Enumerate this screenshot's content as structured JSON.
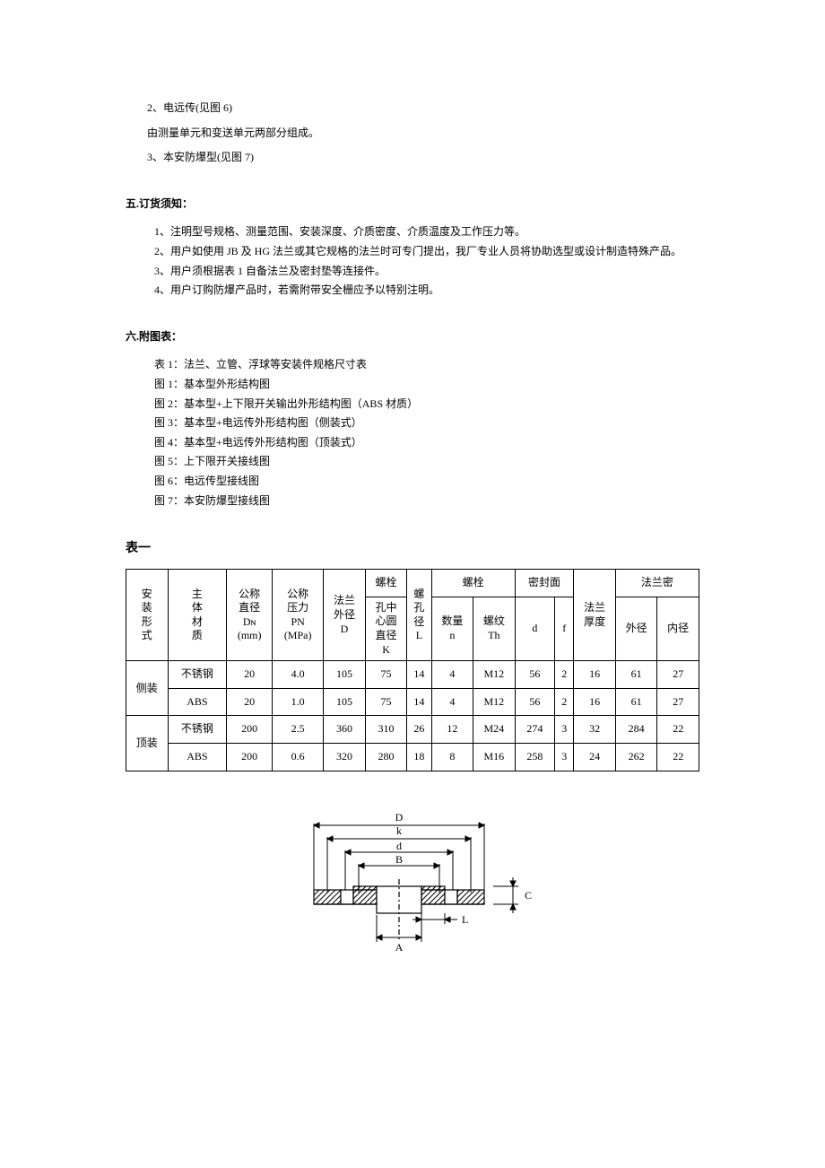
{
  "intro": {
    "line1": "2、电远传(见图 6)",
    "line2": "由测量单元和变送单元两部分组成。",
    "line3": "3、本安防爆型(见图 7)"
  },
  "section5": {
    "title": "五.订货须知：",
    "items": [
      "1、注明型号规格、测量范围、安装深度、介质密度、介质温度及工作压力等。",
      "2、用户如使用 JB 及 HG 法兰或其它规格的法兰时可专门提出，我厂专业人员将协助选型或设计制造特殊产品。",
      "3、用户须根据表 1 自备法兰及密封垫等连接件。",
      "4、用户订购防爆产品时，若需附带安全栅应予以特别注明。"
    ]
  },
  "section6": {
    "title": "六.附图表：",
    "items": [
      "表 1：法兰、立管、浮球等安装件规格尺寸表",
      "图 1：基本型外形结构图",
      "图 2：基本型+上下限开关输出外形结构图（ABS 材质）",
      "图 3：基本型+电远传外形结构图（侧装式）",
      "图 4：基本型+电远传外形结构图（顶装式）",
      "图 5：上下限开关接线图",
      "图 6：电远传型接线图",
      "图 7：本安防爆型接线图"
    ]
  },
  "tableTitle": "表一",
  "table": {
    "headers": {
      "c1": "安\n装\n形\n式",
      "c2": "主\n体\n材\n质",
      "c3a": "公称",
      "c3b": "直径",
      "c3c": "Dɴ",
      "c3d": "(mm)",
      "c4a": "公称",
      "c4b": "压力",
      "c4c": "PN",
      "c4d": "(MPa)",
      "c5a": "法兰",
      "c5b": "外径",
      "c5c": "D",
      "c6g": "螺栓",
      "c6a": "孔中",
      "c6b": "心圆",
      "c6c": "直径",
      "c6d": "K",
      "c7a": "螺",
      "c7b": "孔",
      "c7c": "径",
      "c7d": "L",
      "c8g": "螺栓",
      "c8a": "数量",
      "c8b": "n",
      "c9a": "螺纹",
      "c9b": "Th",
      "c10g": "密封面",
      "c10a": "d",
      "c11a": "f",
      "c12a": "法兰",
      "c12b": "厚度",
      "c13g": "法兰密",
      "c13a": "外径",
      "c14a": "内径"
    },
    "rows": [
      {
        "group": "侧装",
        "mat": "不锈钢",
        "dn": "20",
        "pn": "4.0",
        "D": "105",
        "K": "75",
        "L": "14",
        "n": "4",
        "Th": "M12",
        "d": "56",
        "f": "2",
        "th": "16",
        "od": "61",
        "id": "27"
      },
      {
        "group": "侧装",
        "mat": "ABS",
        "dn": "20",
        "pn": "1.0",
        "D": "105",
        "K": "75",
        "L": "14",
        "n": "4",
        "Th": "M12",
        "d": "56",
        "f": "2",
        "th": "16",
        "od": "61",
        "id": "27"
      },
      {
        "group": "顶装",
        "mat": "不锈钢",
        "dn": "200",
        "pn": "2.5",
        "D": "360",
        "K": "310",
        "L": "26",
        "n": "12",
        "Th": "M24",
        "d": "274",
        "f": "3",
        "th": "32",
        "od": "284",
        "id": "22"
      },
      {
        "group": "顶装",
        "mat": "ABS",
        "dn": "200",
        "pn": "0.6",
        "D": "320",
        "K": "280",
        "L": "18",
        "n": "8",
        "Th": "M16",
        "d": "258",
        "f": "3",
        "th": "24",
        "od": "262",
        "id": "22"
      }
    ]
  },
  "diagram": {
    "labels": {
      "D": "D",
      "k": "k",
      "d": "d",
      "B": "B",
      "A": "A",
      "L": "L",
      "C": "C"
    }
  }
}
